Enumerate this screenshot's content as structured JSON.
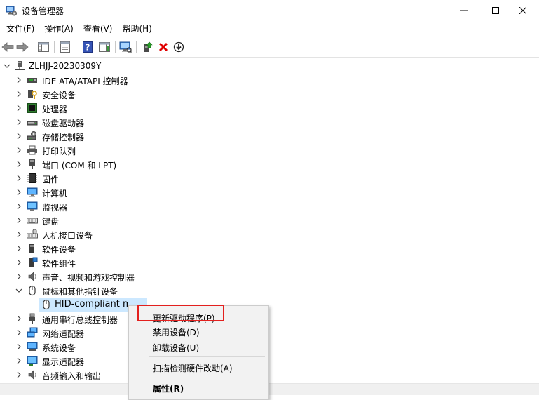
{
  "window": {
    "title": "设备管理器",
    "minimize_icon": "minimize-icon",
    "maximize_icon": "maximize-icon",
    "close_icon": "close-icon"
  },
  "menu": [
    "文件(F)",
    "操作(A)",
    "查看(V)",
    "帮助(H)"
  ],
  "toolbar": {
    "icons": [
      "back-arrow-icon",
      "forward-arrow-icon",
      "show-hide-console-tree-icon",
      "properties-icon",
      "help-icon",
      "action-pane-icon",
      "scan-hardware-icon",
      "update-driver-icon",
      "uninstall-device-icon",
      "disable-device-icon"
    ],
    "uninstall_color": "#e00000"
  },
  "tree": {
    "root": "ZLHJJ-20230309Y",
    "categories": [
      {
        "label": "IDE ATA/ATAPI 控制器",
        "icon": "ide-controller-icon"
      },
      {
        "label": "安全设备",
        "icon": "security-device-icon"
      },
      {
        "label": "处理器",
        "icon": "processor-icon"
      },
      {
        "label": "磁盘驱动器",
        "icon": "disk-drive-icon"
      },
      {
        "label": "存储控制器",
        "icon": "storage-controller-icon"
      },
      {
        "label": "打印队列",
        "icon": "printer-icon"
      },
      {
        "label": "端口 (COM 和 LPT)",
        "icon": "port-icon"
      },
      {
        "label": "固件",
        "icon": "firmware-icon"
      },
      {
        "label": "计算机",
        "icon": "computer-icon"
      },
      {
        "label": "监视器",
        "icon": "monitor-icon"
      },
      {
        "label": "键盘",
        "icon": "keyboard-icon"
      },
      {
        "label": "人机接口设备",
        "icon": "hid-icon"
      },
      {
        "label": "软件设备",
        "icon": "software-device-icon"
      },
      {
        "label": "软件组件",
        "icon": "software-component-icon"
      },
      {
        "label": "声音、视频和游戏控制器",
        "icon": "sound-icon"
      },
      {
        "label": "鼠标和其他指针设备",
        "icon": "mouse-icon",
        "expanded": true
      },
      {
        "label": "通用串行总线控制器",
        "icon": "usb-icon"
      },
      {
        "label": "网络适配器",
        "icon": "network-adapter-icon"
      },
      {
        "label": "系统设备",
        "icon": "system-device-icon"
      },
      {
        "label": "显示适配器",
        "icon": "display-adapter-icon"
      },
      {
        "label": "音频输入和输出",
        "icon": "audio-io-icon"
      }
    ],
    "selected_child": "HID-compliant mouse",
    "selection_color": "#cce8ff"
  },
  "context_menu": {
    "items": [
      "更新驱动程序(P)",
      "禁用设备(D)",
      "卸载设备(U)",
      "扫描检测硬件改动(A)",
      "属性(R)"
    ],
    "highlight_color": "#e3201e"
  }
}
